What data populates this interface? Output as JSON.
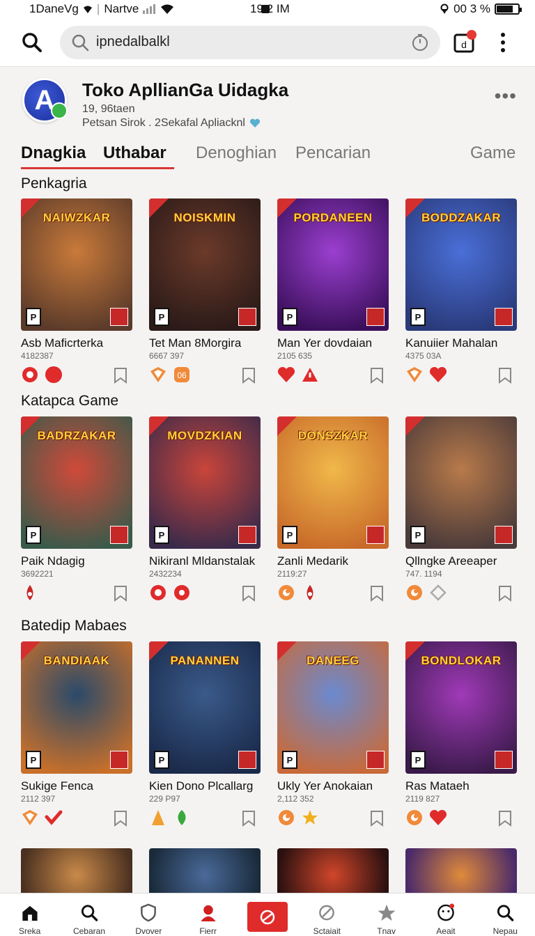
{
  "status_bar": {
    "left_text": "1DaneVg",
    "carrier": "Nartve",
    "time": "19.2 IM",
    "right_text": "00 3 %",
    "battery_level": 0.75
  },
  "search": {
    "value": "ipnedalbalkl"
  },
  "profile": {
    "title": "Toko ApllianGa Uidagka",
    "avatar_letter": "A",
    "subtitle": "19, 96taen",
    "description": "Petsan Sirok . 2Sekafal Apliacknl"
  },
  "tabs": [
    "Dnagkia",
    "Uthabar",
    "Denoghian",
    "Pencarian",
    "Game"
  ],
  "sections": [
    {
      "title": "Penkagria",
      "items": [
        {
          "name": "Asb Maficrterka",
          "count": "4182387",
          "logo": "NAIWZKAR",
          "colors": [
            "#c97a3a",
            "#5a3a2a"
          ],
          "icons": [
            "target-icon",
            "circle-icon"
          ]
        },
        {
          "name": "Tet Man 8Morgira",
          "count": "6667 397",
          "logo": "NOISKMIN",
          "colors": [
            "#6b3a2a",
            "#2a1a18"
          ],
          "icons": [
            "shield-icon",
            "badge-icon"
          ]
        },
        {
          "name": "Man Yer dovdaian",
          "count": "2105 635",
          "logo": "PORDANEEN",
          "colors": [
            "#9b3fd0",
            "#3a0f5a"
          ],
          "icons": [
            "heart-icon",
            "warning-icon"
          ]
        },
        {
          "name": "Kanuiier Mahalan",
          "count": "4375 03A",
          "logo": "BODDZAKAR",
          "colors": [
            "#4a6fd8",
            "#2a3a7a"
          ],
          "icons": [
            "shield-icon",
            "heart-icon"
          ]
        }
      ]
    },
    {
      "title": "Katapca Game",
      "items": [
        {
          "name": "Paik Ndagig",
          "count": "3692221",
          "logo": "BADRZAKAR",
          "colors": [
            "#d04a3a",
            "#3a5a4a"
          ],
          "icons": [
            "drop-icon"
          ]
        },
        {
          "name": "Nikiranl Mldanstalak",
          "count": "2432234",
          "logo": "MOVDZKIAN",
          "colors": [
            "#c9453a",
            "#3a2a4a"
          ],
          "icons": [
            "target-icon",
            "gear-icon"
          ]
        },
        {
          "name": "Zanli Medarik",
          "count": "2119:27",
          "logo": "DONSZKAR",
          "colors": [
            "#f0b84a",
            "#c86a2a"
          ],
          "icons": [
            "swirl-icon",
            "drop-icon"
          ]
        },
        {
          "name": "Qllngke Areeaper",
          "count": "747. 1194",
          "logo": "",
          "colors": [
            "#b87a4a",
            "#4a3a3a"
          ],
          "icons": [
            "swirl-icon",
            "diamond-icon"
          ]
        }
      ]
    },
    {
      "title": "Batedip Mabaes",
      "items": [
        {
          "name": "Sukige Fenca",
          "count": "2112 397",
          "logo": "BANDIAAK",
          "colors": [
            "#2a4a6a",
            "#c9702a"
          ],
          "icons": [
            "shield-icon",
            "check-icon"
          ]
        },
        {
          "name": "Kien Dono Plcallarg",
          "count": "229 P97",
          "logo": "PANANNEN",
          "colors": [
            "#3a5a8a",
            "#1a2a4a"
          ],
          "icons": [
            "cone-icon",
            "leaf-icon"
          ]
        },
        {
          "name": "Ukly Yer Anokaian",
          "count": "2,112 352",
          "logo": "DANEEG",
          "colors": [
            "#6a8ad0",
            "#c86a3a"
          ],
          "icons": [
            "swirl-icon",
            "star-icon"
          ]
        },
        {
          "name": "Ras Mataeh",
          "count": "2119 827",
          "logo": "BONDLOKAR",
          "colors": [
            "#a03ab8",
            "#3a1a4a"
          ],
          "icons": [
            "swirl-icon",
            "heart-icon"
          ]
        }
      ]
    }
  ],
  "peek_colors": [
    [
      "#c98a4a",
      "#4a3020"
    ],
    [
      "#4a6a9a",
      "#1a2a3a"
    ],
    [
      "#d0462a",
      "#2a1010"
    ],
    [
      "#e08a3a",
      "#4a2a6a"
    ]
  ],
  "bottom_nav": [
    {
      "label": "Sreka",
      "icon": "home-icon"
    },
    {
      "label": "Cebaran",
      "icon": "search-icon"
    },
    {
      "label": "Dvover",
      "icon": "shield-icon"
    },
    {
      "label": "Fierr",
      "icon": "person-icon"
    },
    {
      "label": "",
      "icon": "game-icon"
    },
    {
      "label": "Sctaiait",
      "icon": "ban-icon"
    },
    {
      "label": "Tnav",
      "icon": "star-icon"
    },
    {
      "label": "Aeait",
      "icon": "face-icon"
    },
    {
      "label": "Nepau",
      "icon": "search-icon"
    }
  ]
}
